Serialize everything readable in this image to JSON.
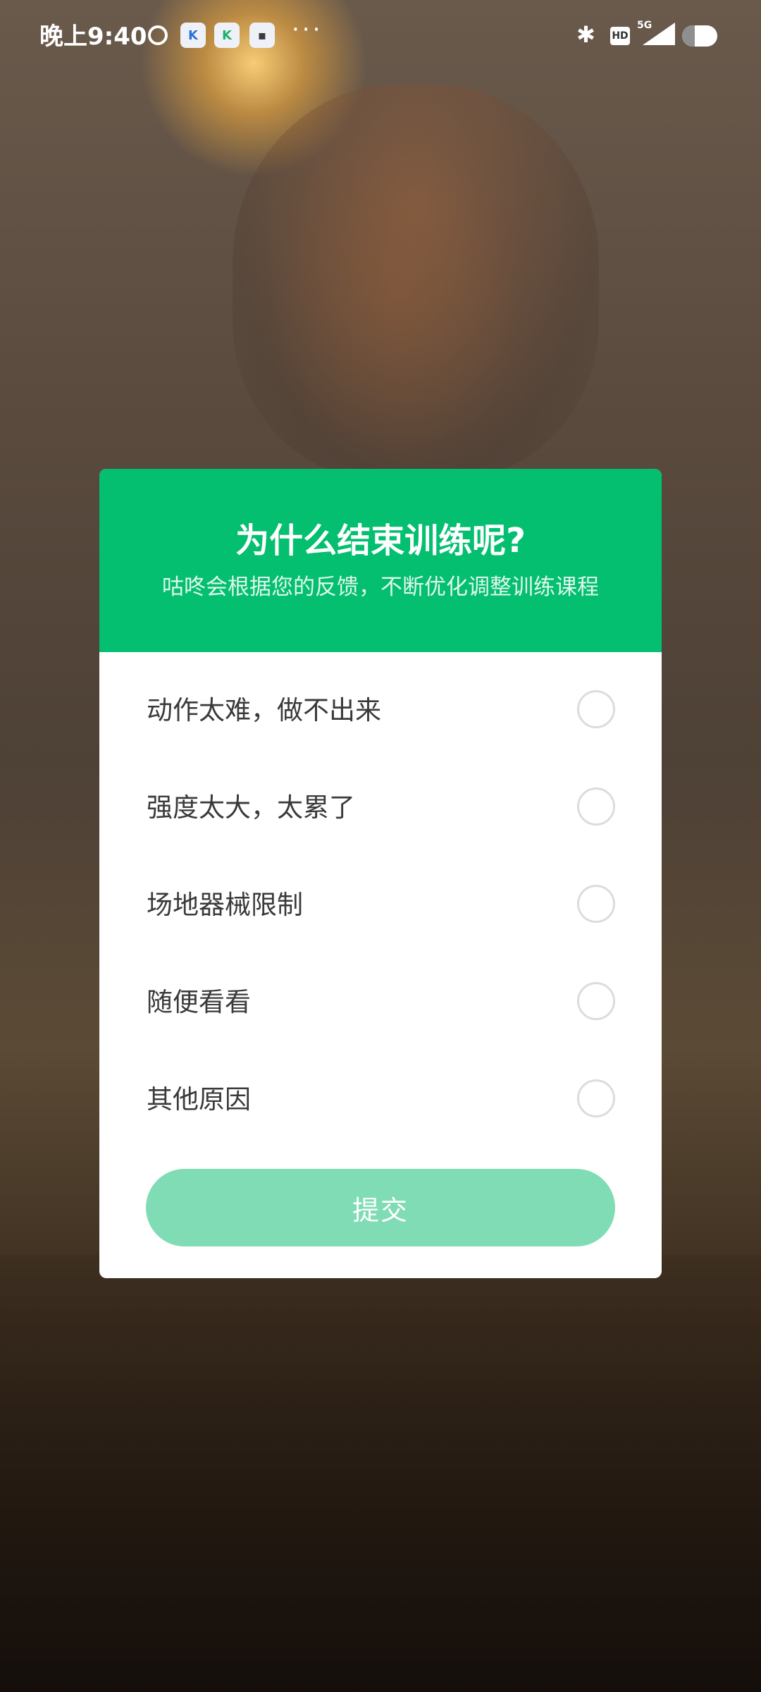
{
  "status_bar": {
    "time": "晚上9:40",
    "icons": [
      "alarm-icon",
      "app-k-icon",
      "app-k2-icon",
      "app-news-icon",
      "more-icon",
      "bluetooth-icon",
      "hd-icon",
      "signal-5g-icon",
      "battery-icon"
    ],
    "hd_label": "HD",
    "network_label": "5G",
    "app_k_label": "K",
    "app_k2_label": "K",
    "more_label": "···"
  },
  "dialog": {
    "title": "为什么结束训练呢?",
    "subtitle": "咕咚会根据您的反馈，不断优化调整训练课程",
    "options": [
      {
        "label": "动作太难，做不出来"
      },
      {
        "label": "强度太大，太累了"
      },
      {
        "label": "场地器械限制"
      },
      {
        "label": "随便看看"
      },
      {
        "label": "其他原因"
      }
    ],
    "submit_label": "提交"
  },
  "colors": {
    "header_green": "#03bf6f",
    "submit_disabled": "#7fdcb5",
    "radio_border": "#dcdcdc"
  }
}
